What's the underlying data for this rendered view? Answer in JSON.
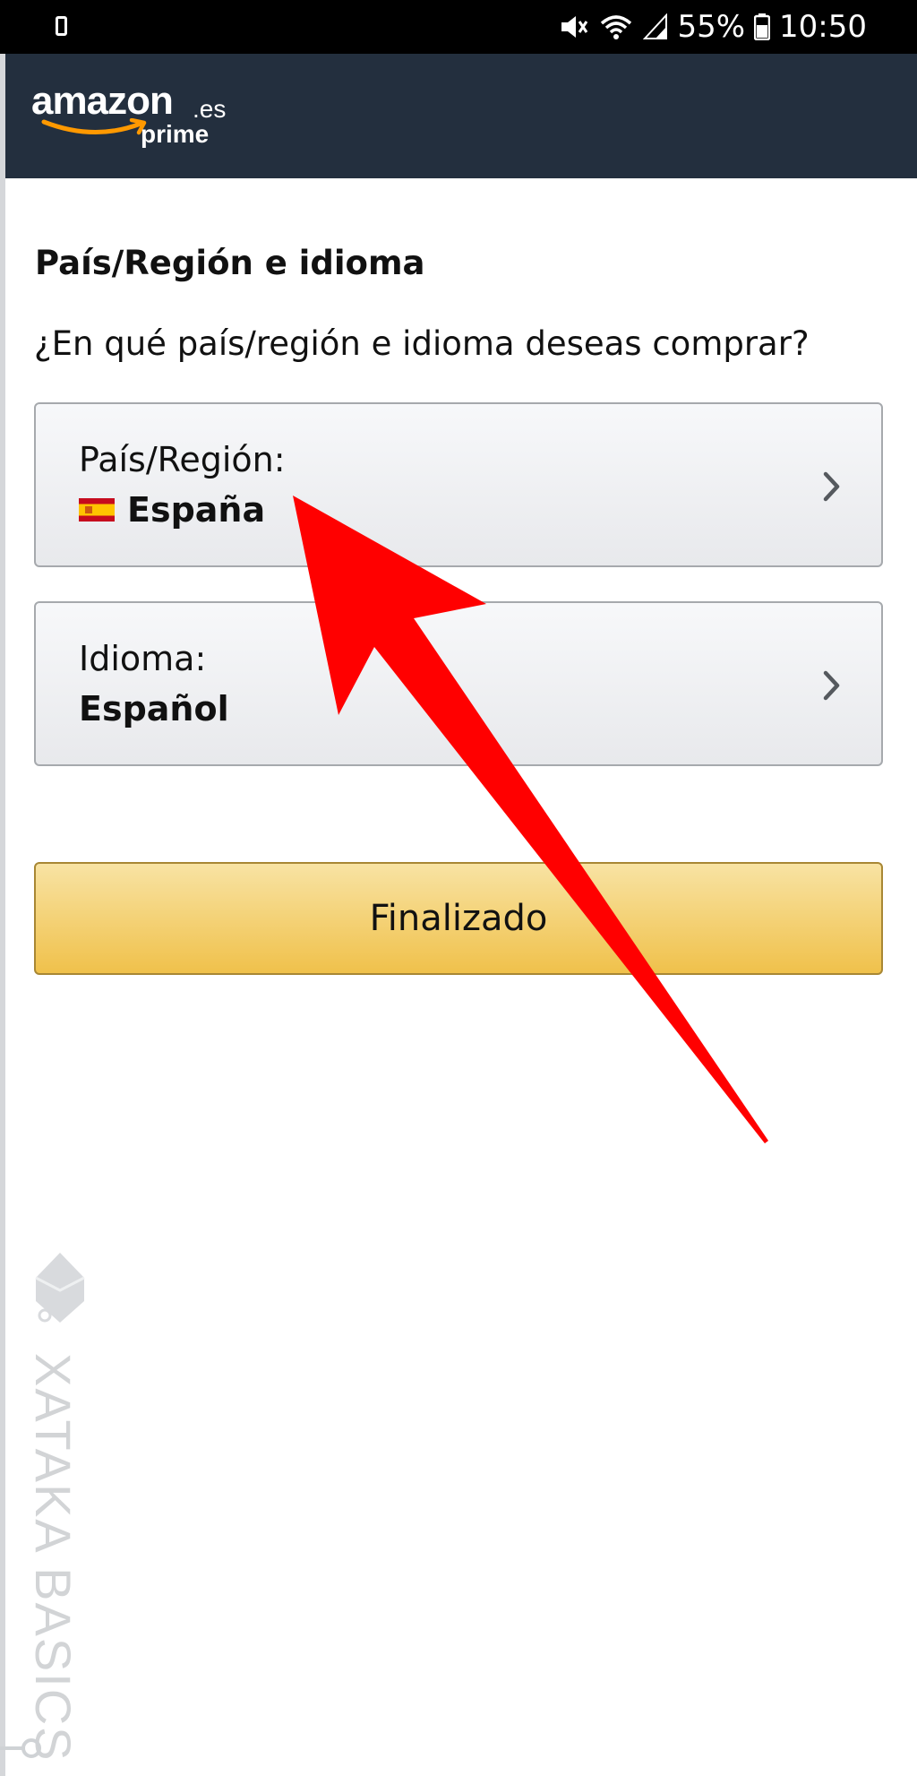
{
  "status_bar": {
    "battery_percent": "55%",
    "time": "10:50",
    "icons": [
      "phone-icon",
      "mute-icon",
      "wifi-icon",
      "signal-icon",
      "battery-icon"
    ]
  },
  "header": {
    "logo_word": "amazon",
    "logo_tld": ".es",
    "logo_prime": "prime",
    "background": "#232f3e",
    "smile_color": "#ff9900"
  },
  "main": {
    "title": "País/Región e idioma",
    "question": "¿En qué país/región e idioma deseas comprar?",
    "country": {
      "label": "País/Región:",
      "value": "España",
      "flag_icon": "spain-flag-icon"
    },
    "language": {
      "label": "Idioma:",
      "value": "Español"
    },
    "done_button": "Finalizado",
    "button_color": "#f0c14b"
  },
  "annotation": {
    "type": "red-arrow",
    "color": "#ff0000"
  },
  "watermark": {
    "text": "XATAKA BASICS"
  }
}
